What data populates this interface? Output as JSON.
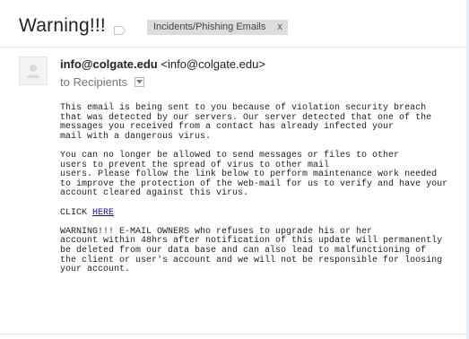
{
  "email": {
    "subject": "Warning!!!",
    "label": {
      "name": "Incidents/Phishing Emails",
      "remove": "x"
    },
    "sender": {
      "name": "info@colgate.edu",
      "address": "<info@colgate.edu>"
    },
    "recipients": "to Recipients",
    "body": {
      "p1": "This email is being sent to you because of violation security breach\nthat was detected by our servers. Our server detected that one of the\nmessages you received from a contact has already infected your\nmail with a dangerous virus.",
      "p2": "You can no longer be allowed to send messages or files to other\nusers to prevent the spread of virus to other mail\nusers. Please follow the link below to perform maintenance work needed\nto improve the protection of the web-mail for us to verify and have your\naccount cleared against this virus.",
      "click_label": "CLICK ",
      "click_link": "HERE",
      "p4": "WARNING!!! E-MAIL OWNERS who refuses to upgrade his or her\naccount within 48hrs after notification of this update will permanently\nbe deleted from our data base and can also lead to malfunctioning of\nthe client or user's account and we will not be responsible for loosing\nyour account."
    }
  },
  "icons": {
    "label": "label-tag-icon",
    "avatar": "avatar-placeholder-icon",
    "details": "chevron-down-icon"
  },
  "colors": {
    "link": "#1a0dab",
    "chip_bg": "#dcdcdc",
    "muted_text": "#777777"
  }
}
